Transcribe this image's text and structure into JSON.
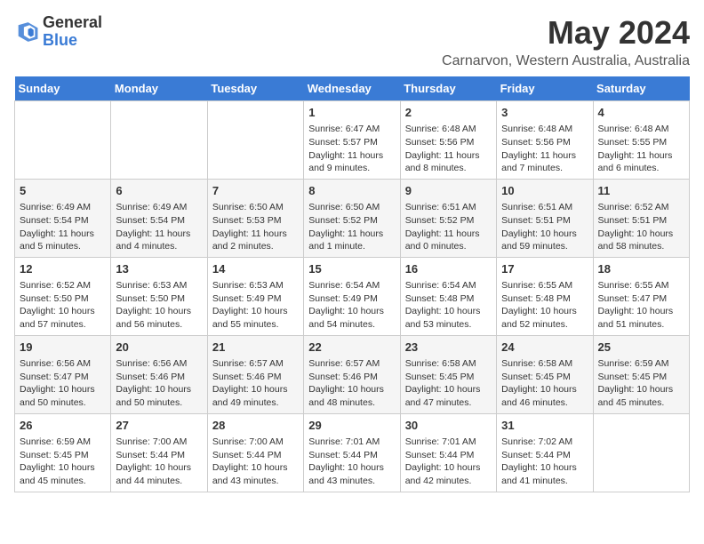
{
  "logo": {
    "line1": "General",
    "line2": "Blue"
  },
  "title": "May 2024",
  "location": "Carnarvon, Western Australia, Australia",
  "weekdays": [
    "Sunday",
    "Monday",
    "Tuesday",
    "Wednesday",
    "Thursday",
    "Friday",
    "Saturday"
  ],
  "weeks": [
    [
      {
        "day": "",
        "info": ""
      },
      {
        "day": "",
        "info": ""
      },
      {
        "day": "",
        "info": ""
      },
      {
        "day": "1",
        "info": "Sunrise: 6:47 AM\nSunset: 5:57 PM\nDaylight: 11 hours and 9 minutes."
      },
      {
        "day": "2",
        "info": "Sunrise: 6:48 AM\nSunset: 5:56 PM\nDaylight: 11 hours and 8 minutes."
      },
      {
        "day": "3",
        "info": "Sunrise: 6:48 AM\nSunset: 5:56 PM\nDaylight: 11 hours and 7 minutes."
      },
      {
        "day": "4",
        "info": "Sunrise: 6:48 AM\nSunset: 5:55 PM\nDaylight: 11 hours and 6 minutes."
      }
    ],
    [
      {
        "day": "5",
        "info": "Sunrise: 6:49 AM\nSunset: 5:54 PM\nDaylight: 11 hours and 5 minutes."
      },
      {
        "day": "6",
        "info": "Sunrise: 6:49 AM\nSunset: 5:54 PM\nDaylight: 11 hours and 4 minutes."
      },
      {
        "day": "7",
        "info": "Sunrise: 6:50 AM\nSunset: 5:53 PM\nDaylight: 11 hours and 2 minutes."
      },
      {
        "day": "8",
        "info": "Sunrise: 6:50 AM\nSunset: 5:52 PM\nDaylight: 11 hours and 1 minute."
      },
      {
        "day": "9",
        "info": "Sunrise: 6:51 AM\nSunset: 5:52 PM\nDaylight: 11 hours and 0 minutes."
      },
      {
        "day": "10",
        "info": "Sunrise: 6:51 AM\nSunset: 5:51 PM\nDaylight: 10 hours and 59 minutes."
      },
      {
        "day": "11",
        "info": "Sunrise: 6:52 AM\nSunset: 5:51 PM\nDaylight: 10 hours and 58 minutes."
      }
    ],
    [
      {
        "day": "12",
        "info": "Sunrise: 6:52 AM\nSunset: 5:50 PM\nDaylight: 10 hours and 57 minutes."
      },
      {
        "day": "13",
        "info": "Sunrise: 6:53 AM\nSunset: 5:50 PM\nDaylight: 10 hours and 56 minutes."
      },
      {
        "day": "14",
        "info": "Sunrise: 6:53 AM\nSunset: 5:49 PM\nDaylight: 10 hours and 55 minutes."
      },
      {
        "day": "15",
        "info": "Sunrise: 6:54 AM\nSunset: 5:49 PM\nDaylight: 10 hours and 54 minutes."
      },
      {
        "day": "16",
        "info": "Sunrise: 6:54 AM\nSunset: 5:48 PM\nDaylight: 10 hours and 53 minutes."
      },
      {
        "day": "17",
        "info": "Sunrise: 6:55 AM\nSunset: 5:48 PM\nDaylight: 10 hours and 52 minutes."
      },
      {
        "day": "18",
        "info": "Sunrise: 6:55 AM\nSunset: 5:47 PM\nDaylight: 10 hours and 51 minutes."
      }
    ],
    [
      {
        "day": "19",
        "info": "Sunrise: 6:56 AM\nSunset: 5:47 PM\nDaylight: 10 hours and 50 minutes."
      },
      {
        "day": "20",
        "info": "Sunrise: 6:56 AM\nSunset: 5:46 PM\nDaylight: 10 hours and 50 minutes."
      },
      {
        "day": "21",
        "info": "Sunrise: 6:57 AM\nSunset: 5:46 PM\nDaylight: 10 hours and 49 minutes."
      },
      {
        "day": "22",
        "info": "Sunrise: 6:57 AM\nSunset: 5:46 PM\nDaylight: 10 hours and 48 minutes."
      },
      {
        "day": "23",
        "info": "Sunrise: 6:58 AM\nSunset: 5:45 PM\nDaylight: 10 hours and 47 minutes."
      },
      {
        "day": "24",
        "info": "Sunrise: 6:58 AM\nSunset: 5:45 PM\nDaylight: 10 hours and 46 minutes."
      },
      {
        "day": "25",
        "info": "Sunrise: 6:59 AM\nSunset: 5:45 PM\nDaylight: 10 hours and 45 minutes."
      }
    ],
    [
      {
        "day": "26",
        "info": "Sunrise: 6:59 AM\nSunset: 5:45 PM\nDaylight: 10 hours and 45 minutes."
      },
      {
        "day": "27",
        "info": "Sunrise: 7:00 AM\nSunset: 5:44 PM\nDaylight: 10 hours and 44 minutes."
      },
      {
        "day": "28",
        "info": "Sunrise: 7:00 AM\nSunset: 5:44 PM\nDaylight: 10 hours and 43 minutes."
      },
      {
        "day": "29",
        "info": "Sunrise: 7:01 AM\nSunset: 5:44 PM\nDaylight: 10 hours and 43 minutes."
      },
      {
        "day": "30",
        "info": "Sunrise: 7:01 AM\nSunset: 5:44 PM\nDaylight: 10 hours and 42 minutes."
      },
      {
        "day": "31",
        "info": "Sunrise: 7:02 AM\nSunset: 5:44 PM\nDaylight: 10 hours and 41 minutes."
      },
      {
        "day": "",
        "info": ""
      }
    ]
  ]
}
